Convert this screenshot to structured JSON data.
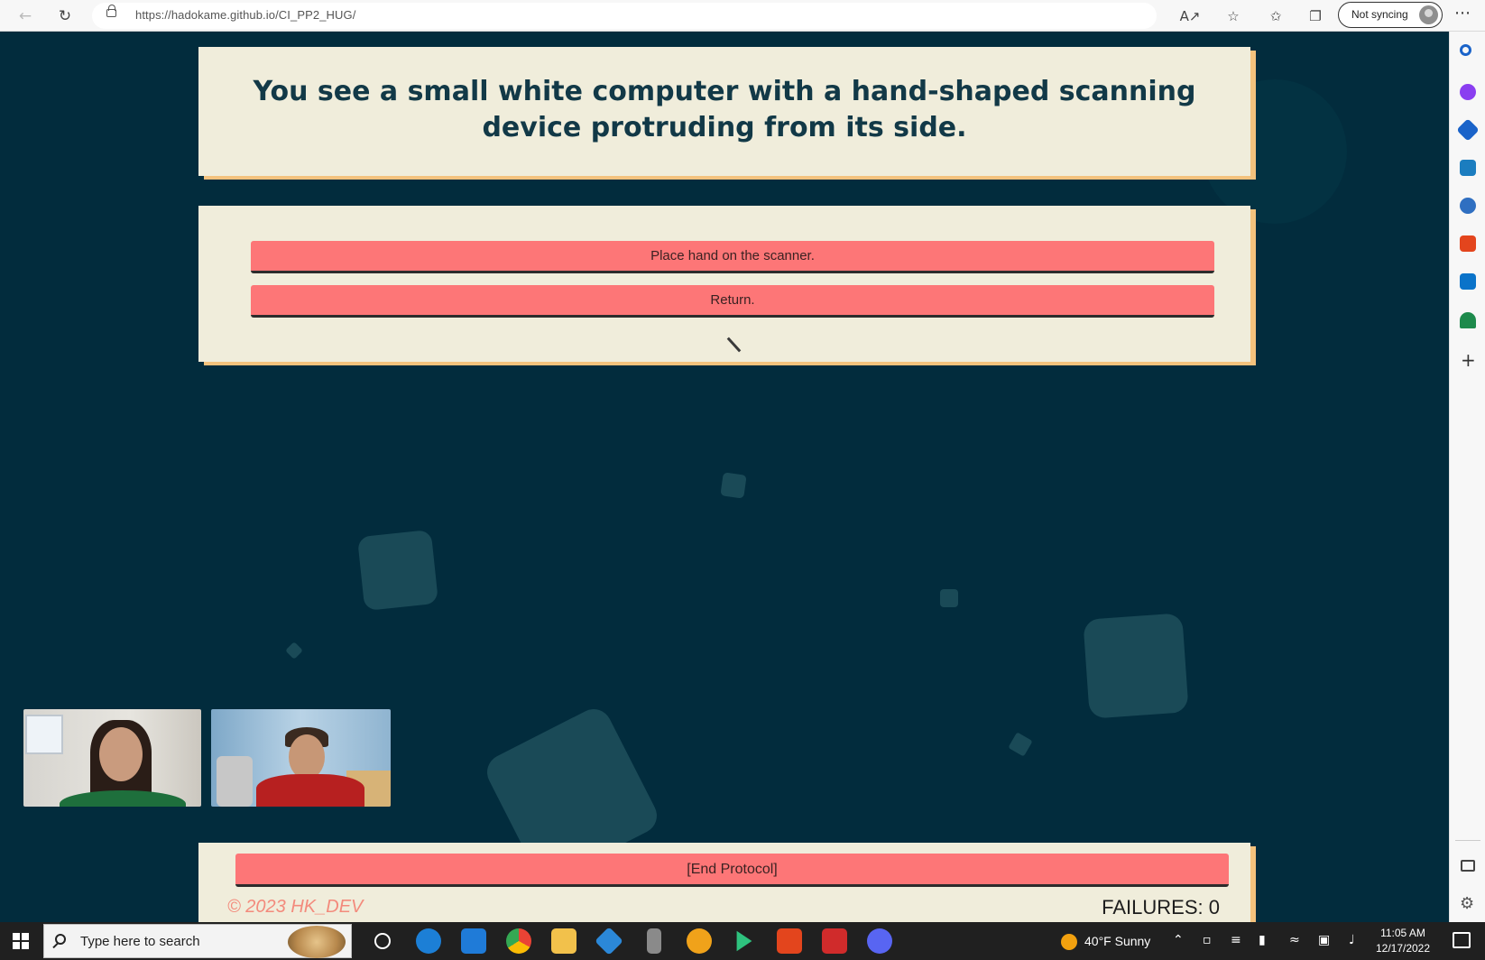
{
  "browser": {
    "url": "https://hadokame.github.io/CI_PP2_HUG/",
    "sync_label": "Not syncing",
    "more_label": "⋯"
  },
  "page": {
    "story_text": "You see a small white computer with a hand-shaped scanning device protruding from its side.",
    "choices": [
      "Place hand on the scanner.",
      "Return."
    ],
    "end_button": "[End Protocol]",
    "copyright": "© 2023 HK_DEV",
    "failures_label": "FAILURES: 0"
  },
  "taskbar": {
    "search_placeholder": "Type here to search",
    "weather": "40°F  Sunny",
    "time": "11:05 AM",
    "date": "12/17/2022"
  },
  "colors": {
    "page_bg": "#022c3d",
    "card_bg": "#f0eddb",
    "card_shadow": "#f4c27d",
    "button_bg": "#fd7677",
    "deco_square": "#1a4a57",
    "copyright_text": "#f38a7c"
  },
  "icons": {
    "browser": [
      "back-icon",
      "reload-icon",
      "lock-icon",
      "read-aloud-icon",
      "add-favorite-icon",
      "favorites-icon",
      "collections-icon",
      "profile-avatar-icon",
      "more-icon"
    ],
    "sidebar": [
      "search-icon",
      "copilot-icon",
      "shopping-icon",
      "tools-icon",
      "games-icon",
      "office-icon",
      "outlook-icon",
      "tree-icon",
      "add-icon",
      "split-screen-icon",
      "settings-icon"
    ],
    "taskbar": [
      "windows-icon",
      "search-icon",
      "task-view-icon",
      "edge-icon",
      "mail-icon",
      "chrome-icon",
      "file-explorer-icon",
      "vscode-icon",
      "usb-icon",
      "app-icon",
      "terminal-icon",
      "office-icon",
      "game-icon",
      "discord-icon",
      "notifications-icon"
    ]
  }
}
